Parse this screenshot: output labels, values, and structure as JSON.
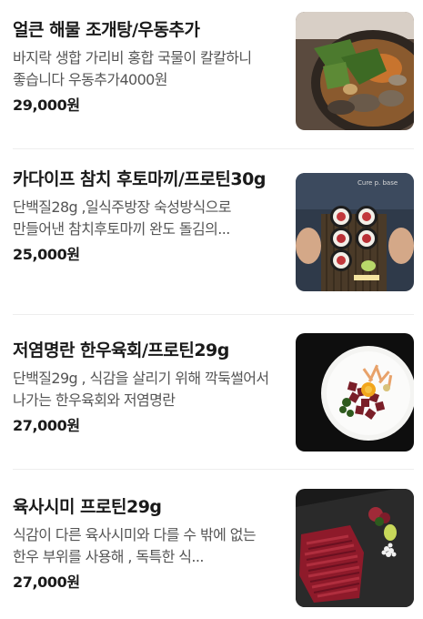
{
  "menu": {
    "items": [
      {
        "title": "얼큰 해물 조개탕/우동추가",
        "description": "바지락 생합 가리비 홍합 국물이 칼칼하니 좋습니다 우동추가4000원",
        "price": "29,000원",
        "image_icon": "seafood-clam-stew-photo"
      },
      {
        "title": "카다이프 참치 후토마끼/프로틴30g",
        "description": "단백질28g ,일식주방장 숙성방식으로 만들어낸 참치후토마끼 완도 돌김의...",
        "price": "25,000원",
        "image_icon": "tuna-futomaki-photo",
        "image_text": "Cure p. base"
      },
      {
        "title": "저염명란 한우육회/프로틴29g",
        "description": "단백질29g , 식감을 살리기 위해 깍둑썰어서 나가는 한우육회와 저염명란",
        "price": "27,000원",
        "image_icon": "beef-tartare-photo"
      },
      {
        "title": "육사시미 프로틴29g",
        "description": "식감이 다른 육사시미와 다를 수 밖에 없는 한우 부위를 사용해 , 독특한 식...",
        "price": "27,000원",
        "image_icon": "beef-sashimi-photo"
      }
    ]
  }
}
